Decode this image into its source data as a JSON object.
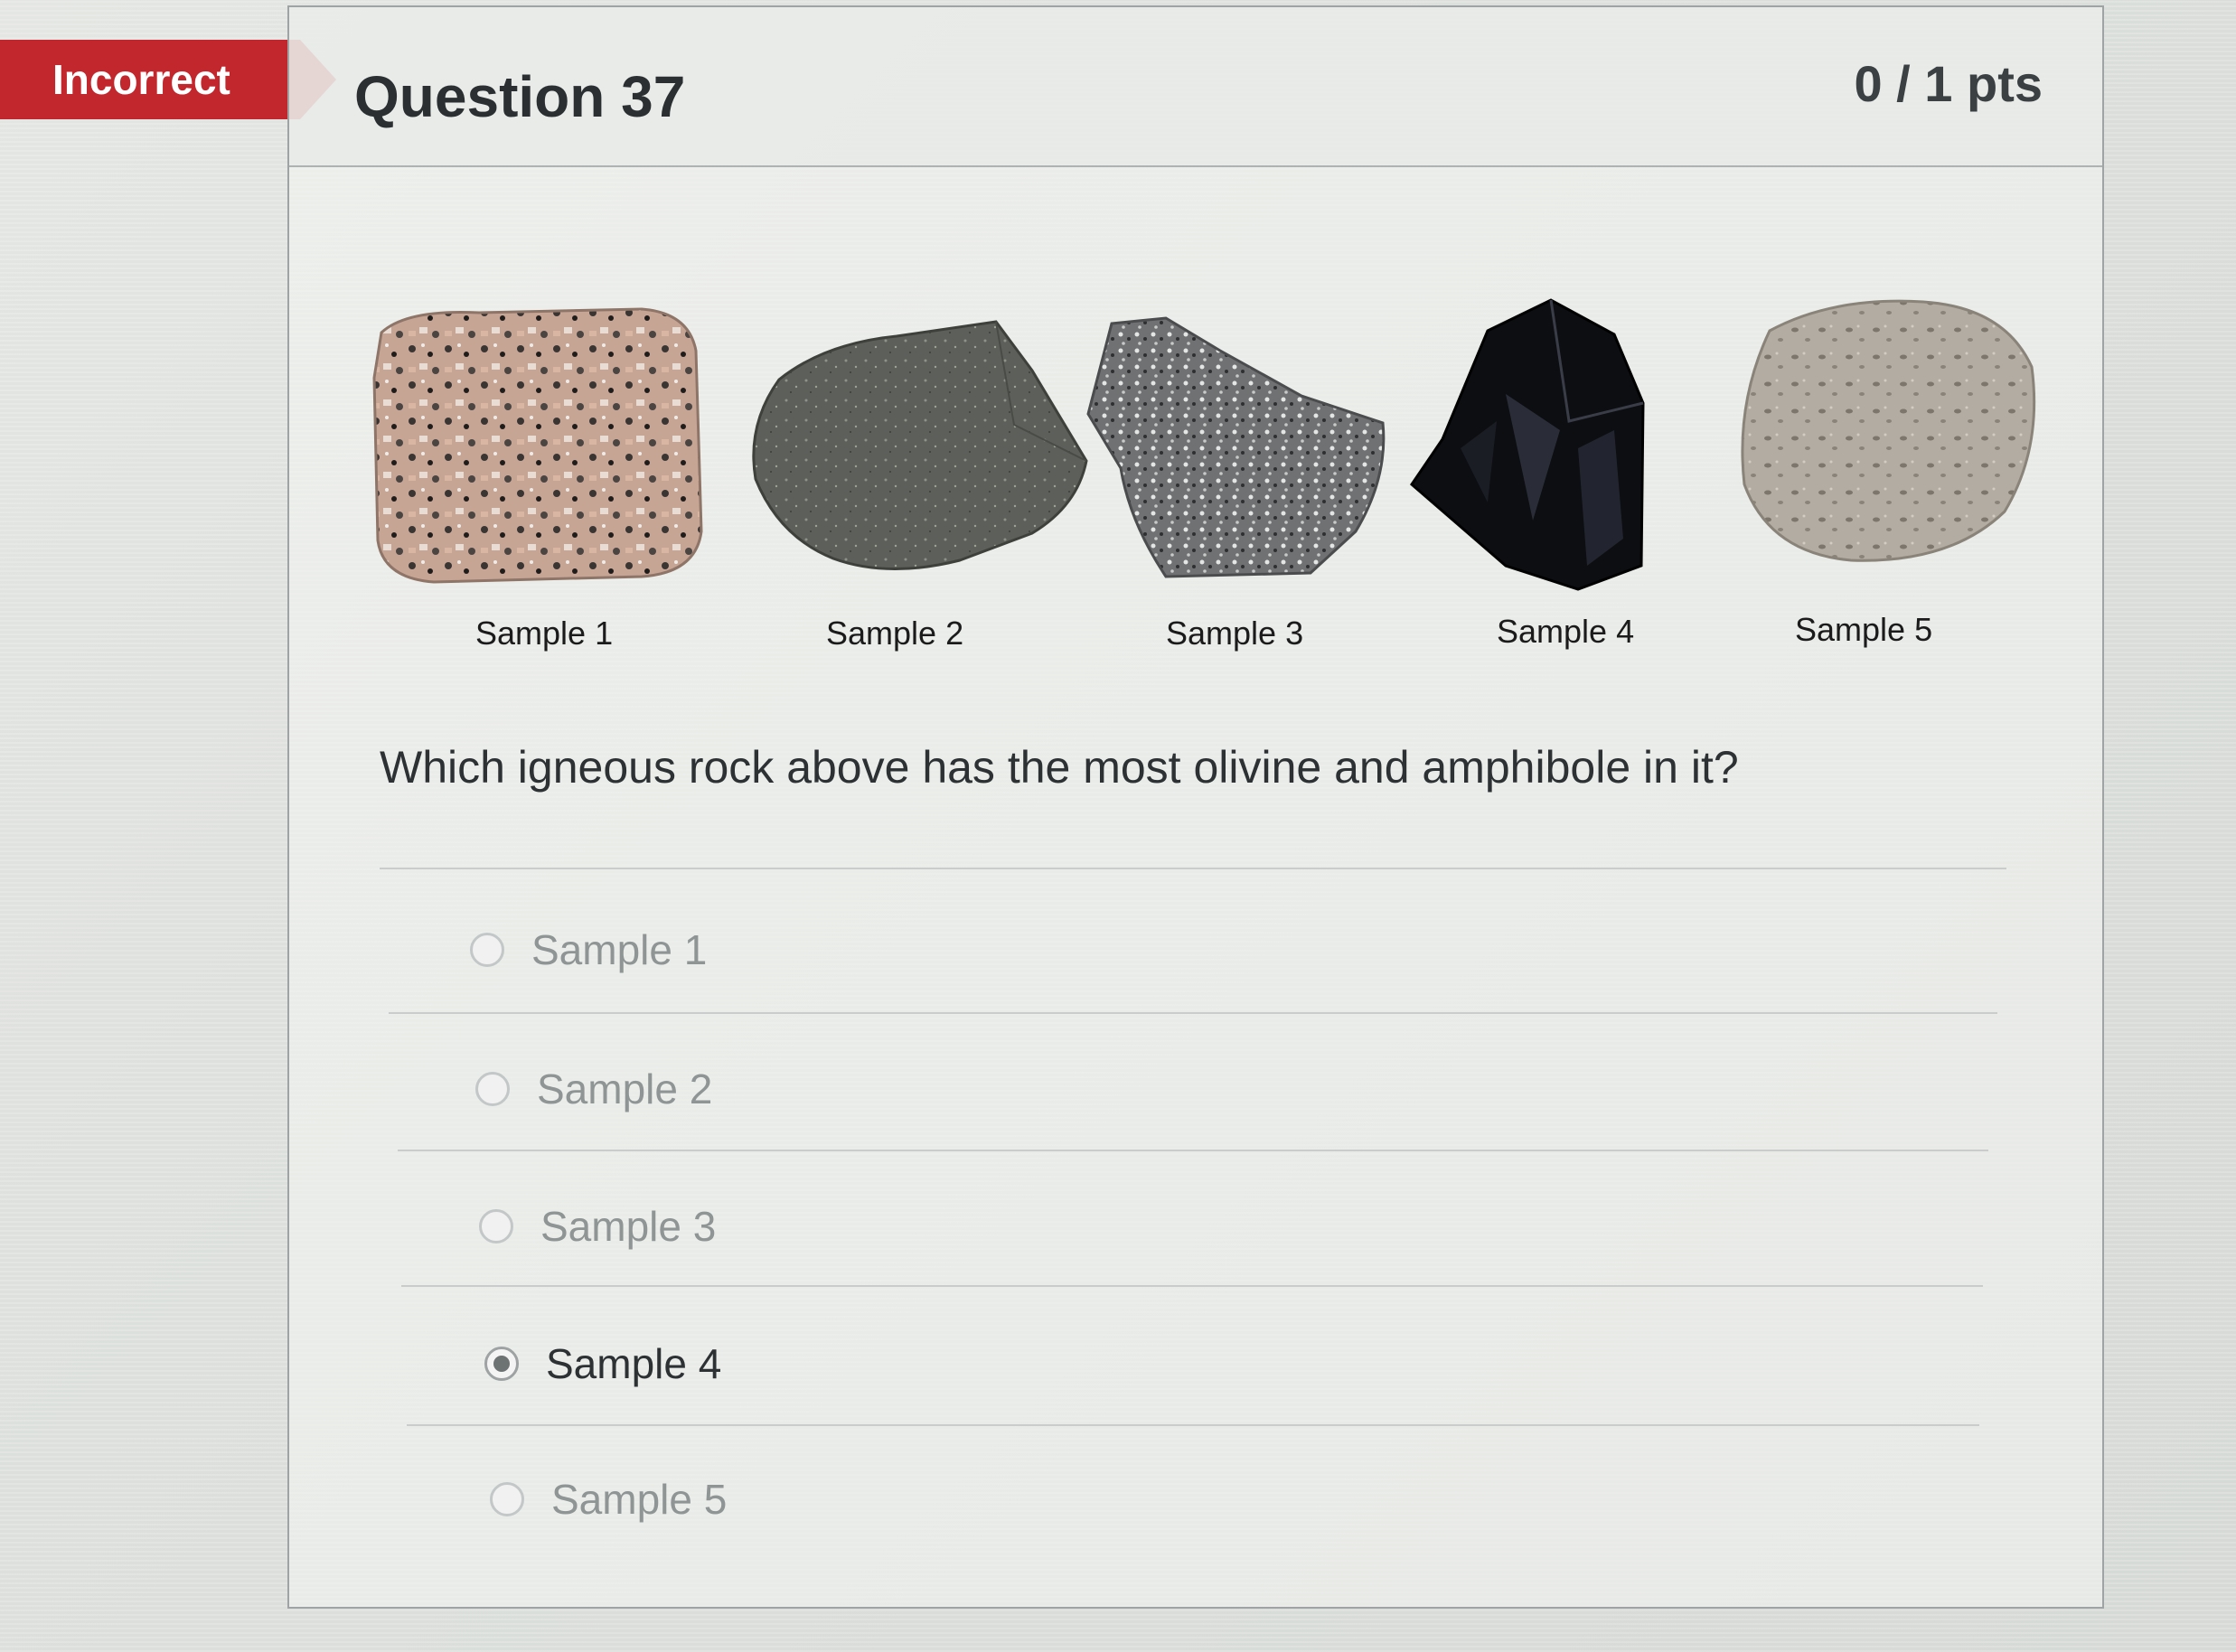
{
  "status_banner": "Incorrect",
  "question": {
    "title": "Question 37",
    "points": "0 / 1 pts",
    "text": "Which igneous rock above has the most olivine and amphibole in it?"
  },
  "samples": [
    {
      "label": "Sample 1",
      "icon": "granite-rock-image"
    },
    {
      "label": "Sample 2",
      "icon": "basalt-rock-image"
    },
    {
      "label": "Sample 3",
      "icon": "diorite-rock-image"
    },
    {
      "label": "Sample 4",
      "icon": "obsidian-rock-image"
    },
    {
      "label": "Sample 5",
      "icon": "pumice-rock-image"
    }
  ],
  "answers": [
    {
      "label": "Sample 1",
      "selected": false
    },
    {
      "label": "Sample 2",
      "selected": false
    },
    {
      "label": "Sample 3",
      "selected": false
    },
    {
      "label": "Sample 4",
      "selected": true
    },
    {
      "label": "Sample 5",
      "selected": false
    }
  ],
  "colors": {
    "incorrect_banner": "#c2272d",
    "card_border": "#9fa3a3"
  }
}
